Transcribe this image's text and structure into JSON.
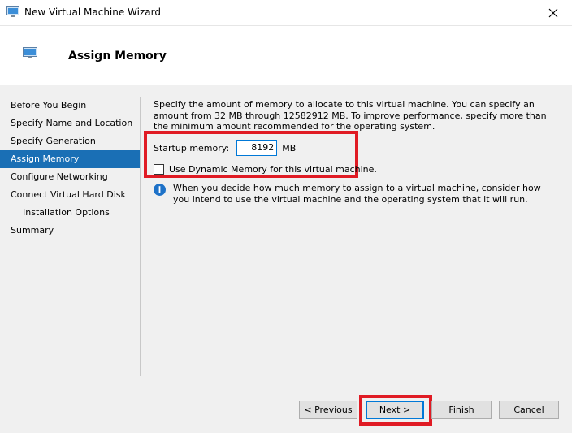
{
  "window": {
    "title": "New Virtual Machine Wizard"
  },
  "header": {
    "title": "Assign Memory"
  },
  "steps": [
    {
      "label": "Before You Begin"
    },
    {
      "label": "Specify Name and Location"
    },
    {
      "label": "Specify Generation"
    },
    {
      "label": "Assign Memory"
    },
    {
      "label": "Configure Networking"
    },
    {
      "label": "Connect Virtual Hard Disk"
    },
    {
      "label": "Installation Options"
    },
    {
      "label": "Summary"
    }
  ],
  "content": {
    "description": "Specify the amount of memory to allocate to this virtual machine. You can specify an amount from 32 MB through 12582912 MB. To improve performance, specify more than the minimum amount recommended for the operating system.",
    "startup_memory_label": "Startup memory:",
    "startup_memory_value": "8192",
    "startup_memory_unit": "MB",
    "dynamic_memory_label": "Use Dynamic Memory for this virtual machine.",
    "dynamic_memory_checked": false,
    "info_text": "When you decide how much memory to assign to a virtual machine, consider how you intend to use the virtual machine and the operating system that it will run."
  },
  "buttons": {
    "previous": "< Previous",
    "next": "Next >",
    "finish": "Finish",
    "cancel": "Cancel"
  },
  "colors": {
    "accent": "#1a6fb5",
    "highlight": "#e01b24",
    "focus": "#0078d7"
  },
  "icons": {
    "app": "virtual-machine-icon",
    "close": "close-icon",
    "info": "info-icon"
  }
}
